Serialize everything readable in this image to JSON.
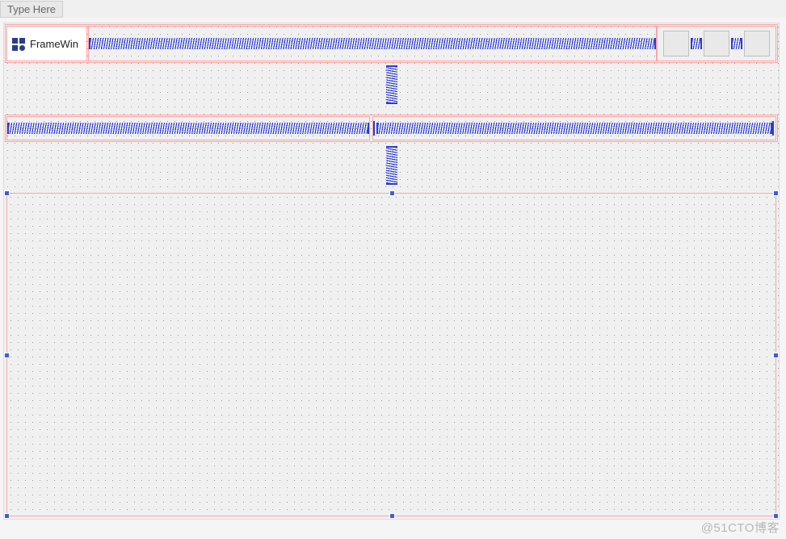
{
  "menu": {
    "placeholder": "Type Here"
  },
  "title": {
    "label": "FrameWin"
  },
  "icons": {
    "app": "app-grid-icon",
    "window_buttons": [
      "min-button",
      "max-button",
      "close-button"
    ]
  },
  "watermark": "@51CTO博客",
  "layout": {
    "springs_horizontal": 4,
    "springs_vertical": 2,
    "selection_handles": 8
  },
  "colors": {
    "selection": "#fca5a5",
    "handle": "#3b5fd9",
    "spring": "#2a3bd1"
  }
}
